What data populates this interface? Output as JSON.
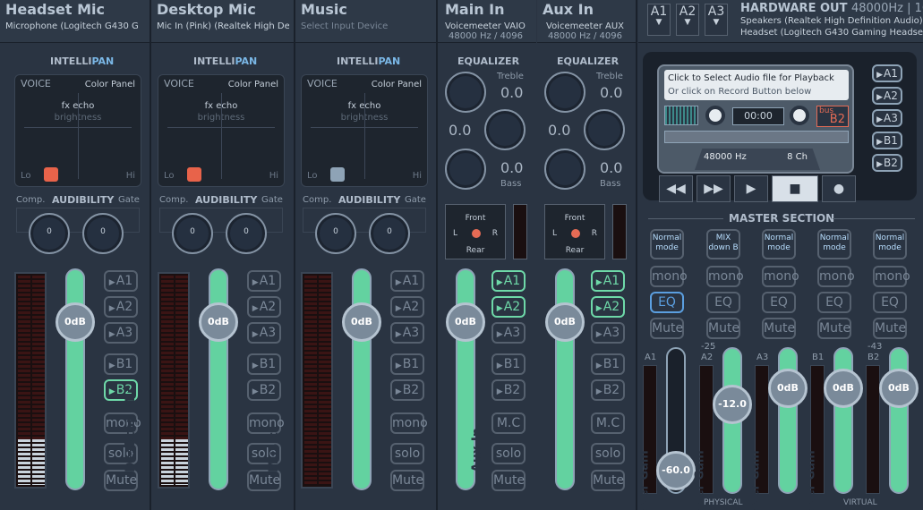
{
  "strips": [
    {
      "title": "Headset Mic",
      "device": "Microphone (Logitech G430 G"
    },
    {
      "title": "Desktop Mic",
      "device": "Mic In (Pink) (Realtek High Def"
    },
    {
      "title": "Music",
      "device": "Select Input Device"
    }
  ],
  "virtual": [
    {
      "title": "Main In",
      "device": "Voicemeeter VAIO",
      "format": "48000 Hz / 4096"
    },
    {
      "title": "Aux In",
      "device": "Voicemeeter AUX",
      "format": "48000 Hz / 4096"
    }
  ],
  "hw_buttons": [
    "A1",
    "A2",
    "A3"
  ],
  "hardware_out": {
    "title": "HARDWARE OUT",
    "rate": "48000Hz | 160",
    "out1": "Speakers (Realtek High Definition Audio)",
    "out2": "Headset (Logitech G430 Gaming Headse"
  },
  "intellipan": {
    "label_a": "INTELLI",
    "label_b": "PAN",
    "voice": "VOICE",
    "color_panel": "Color Panel",
    "fx": "fx echo",
    "bright": "brightness",
    "lo": "Lo",
    "hi": "Hi",
    "dot_colors": [
      "#e8634a",
      "#e8634a",
      "#8ea3b6"
    ]
  },
  "audibility": {
    "comp": "Comp.",
    "label": "AUDIBILITY",
    "gate": "Gate",
    "knob_value": "0"
  },
  "faders": {
    "strip_db": "0dB",
    "names": [
      "Headset Mic",
      "Desktop Mic",
      "Music",
      "Main In",
      "Aux In"
    ]
  },
  "bus_labels": {
    "a1": "A1",
    "a2": "A2",
    "a3": "A3",
    "b1": "B1",
    "b2": "B2",
    "mono": "mono",
    "solo": "solo",
    "mute": "Mute",
    "mc": "M.C"
  },
  "meter_levels": [
    0.22,
    0.22,
    0.0
  ],
  "equalizer": {
    "label": "EQUALIZER",
    "treble": "Treble",
    "bass": "Bass",
    "val": "0.0"
  },
  "spatial": {
    "front": "Front",
    "rear": "Rear",
    "l": "L",
    "r": "R"
  },
  "tape": {
    "line1": "Click to Select Audio file for Playback",
    "line2": "Or click on Record Button below",
    "time": "00:00",
    "bus": "bus",
    "bus_target": "B2",
    "rate": "48000 Hz",
    "channels": "8 Ch"
  },
  "tape_side_buttons": [
    "A1",
    "A2",
    "A3",
    "B1",
    "B2"
  ],
  "master": {
    "label": "MASTER SECTION",
    "modes": [
      {
        "line1": "Normal",
        "line2": "mode"
      },
      {
        "line1": "MIX",
        "line2": "down B"
      },
      {
        "line1": "Normal",
        "line2": "mode"
      },
      {
        "line1": "Normal",
        "line2": "mode"
      },
      {
        "line1": "Normal",
        "line2": "mode"
      }
    ],
    "mono": "mono",
    "eq": "EQ",
    "mute": "Mute",
    "channels": [
      "A1",
      "A2",
      "A3",
      "B1",
      "B2"
    ],
    "top_values": [
      "",
      "-25",
      "",
      "",
      "-43"
    ],
    "fader_values": [
      "-60.0",
      "-12.0",
      "0dB",
      "0dB",
      "0dB"
    ],
    "fader_label": "Fader Gain",
    "physical": "PHYSICAL",
    "virtual_lbl": "VIRTUAL"
  }
}
